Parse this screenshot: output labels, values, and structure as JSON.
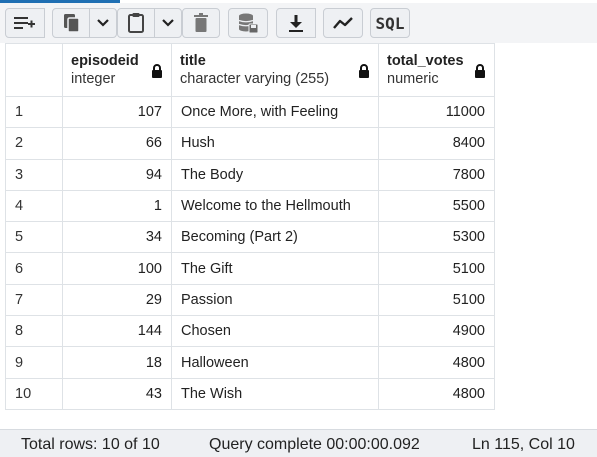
{
  "toolbar": {
    "buttons": [
      {
        "name": "add-row-button",
        "icon": "add-row-icon"
      },
      {
        "name": "copy-button",
        "icon": "copy-icon"
      },
      {
        "name": "copy-options-dropdown",
        "icon": "chevron-down-icon"
      },
      {
        "name": "paste-button",
        "icon": "clipboard-icon"
      },
      {
        "name": "paste-options-dropdown",
        "icon": "chevron-down-icon"
      },
      {
        "name": "delete-button",
        "icon": "trash-icon"
      },
      {
        "name": "save-data-button",
        "icon": "database-save-icon"
      },
      {
        "name": "download-button",
        "icon": "download-icon"
      },
      {
        "name": "graph-button",
        "icon": "line-chart-icon"
      },
      {
        "name": "sql-button",
        "label": "SQL"
      }
    ],
    "sql_label": "SQL"
  },
  "grid": {
    "columns": [
      {
        "name": "episodeid",
        "type": "integer",
        "icon": "lock-icon"
      },
      {
        "name": "title",
        "type": "character varying (255)",
        "icon": "lock-icon"
      },
      {
        "name": "total_votes",
        "type": "numeric",
        "icon": "lock-icon"
      }
    ],
    "rows": [
      {
        "n": "1",
        "episodeid": "107",
        "title": "Once More, with Feeling",
        "total_votes": "11000"
      },
      {
        "n": "2",
        "episodeid": "66",
        "title": "Hush",
        "total_votes": "8400"
      },
      {
        "n": "3",
        "episodeid": "94",
        "title": "The Body",
        "total_votes": "7800"
      },
      {
        "n": "4",
        "episodeid": "1",
        "title": "Welcome to the Hellmouth",
        "total_votes": "5500"
      },
      {
        "n": "5",
        "episodeid": "34",
        "title": "Becoming (Part 2)",
        "total_votes": "5300"
      },
      {
        "n": "6",
        "episodeid": "100",
        "title": "The Gift",
        "total_votes": "5100"
      },
      {
        "n": "7",
        "episodeid": "29",
        "title": "Passion",
        "total_votes": "5100"
      },
      {
        "n": "8",
        "episodeid": "144",
        "title": "Chosen",
        "total_votes": "4900"
      },
      {
        "n": "9",
        "episodeid": "18",
        "title": "Halloween",
        "total_votes": "4800"
      },
      {
        "n": "10",
        "episodeid": "43",
        "title": "The Wish",
        "total_votes": "4800"
      }
    ]
  },
  "status": {
    "total_rows": "Total rows: 10 of 10",
    "query": "Query complete 00:00:00.092",
    "position": "Ln 115, Col 10"
  }
}
